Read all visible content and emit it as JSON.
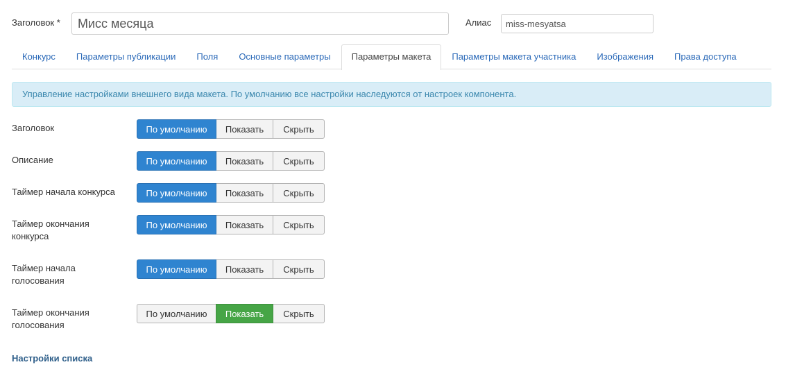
{
  "form": {
    "title_label": "Заголовок *",
    "title_value": "Мисс месяца",
    "alias_label": "Алиас",
    "alias_value": "miss-mesyatsa"
  },
  "tabs": [
    {
      "label": "Конкурс",
      "active": false
    },
    {
      "label": "Параметры публикации",
      "active": false
    },
    {
      "label": "Поля",
      "active": false
    },
    {
      "label": "Основные параметры",
      "active": false
    },
    {
      "label": "Параметры макета",
      "active": true
    },
    {
      "label": "Параметры макета участника",
      "active": false
    },
    {
      "label": "Изображения",
      "active": false
    },
    {
      "label": "Права доступа",
      "active": false
    }
  ],
  "info": "Управление настройками внешнего вида макета. По умолчанию все настройки наследуются от настроек компонента.",
  "options": {
    "default": "По умолчанию",
    "show": "Показать",
    "hide": "Скрыть"
  },
  "rows": [
    {
      "label": "Заголовок",
      "selected": "default"
    },
    {
      "label": "Описание",
      "selected": "default"
    },
    {
      "label": "Таймер начала конкурса",
      "selected": "default"
    },
    {
      "label": "Таймер окончания конкурса",
      "selected": "default"
    },
    {
      "label": "Таймер начала голосования",
      "selected": "default"
    },
    {
      "label": "Таймер окончания голосования",
      "selected": "show"
    }
  ],
  "section_title": "Настройки списка",
  "colors": {
    "selected_default": "#2f84d0",
    "selected_show": "#46a546",
    "link": "#2a69b8",
    "info_bg": "#d9edf7"
  }
}
